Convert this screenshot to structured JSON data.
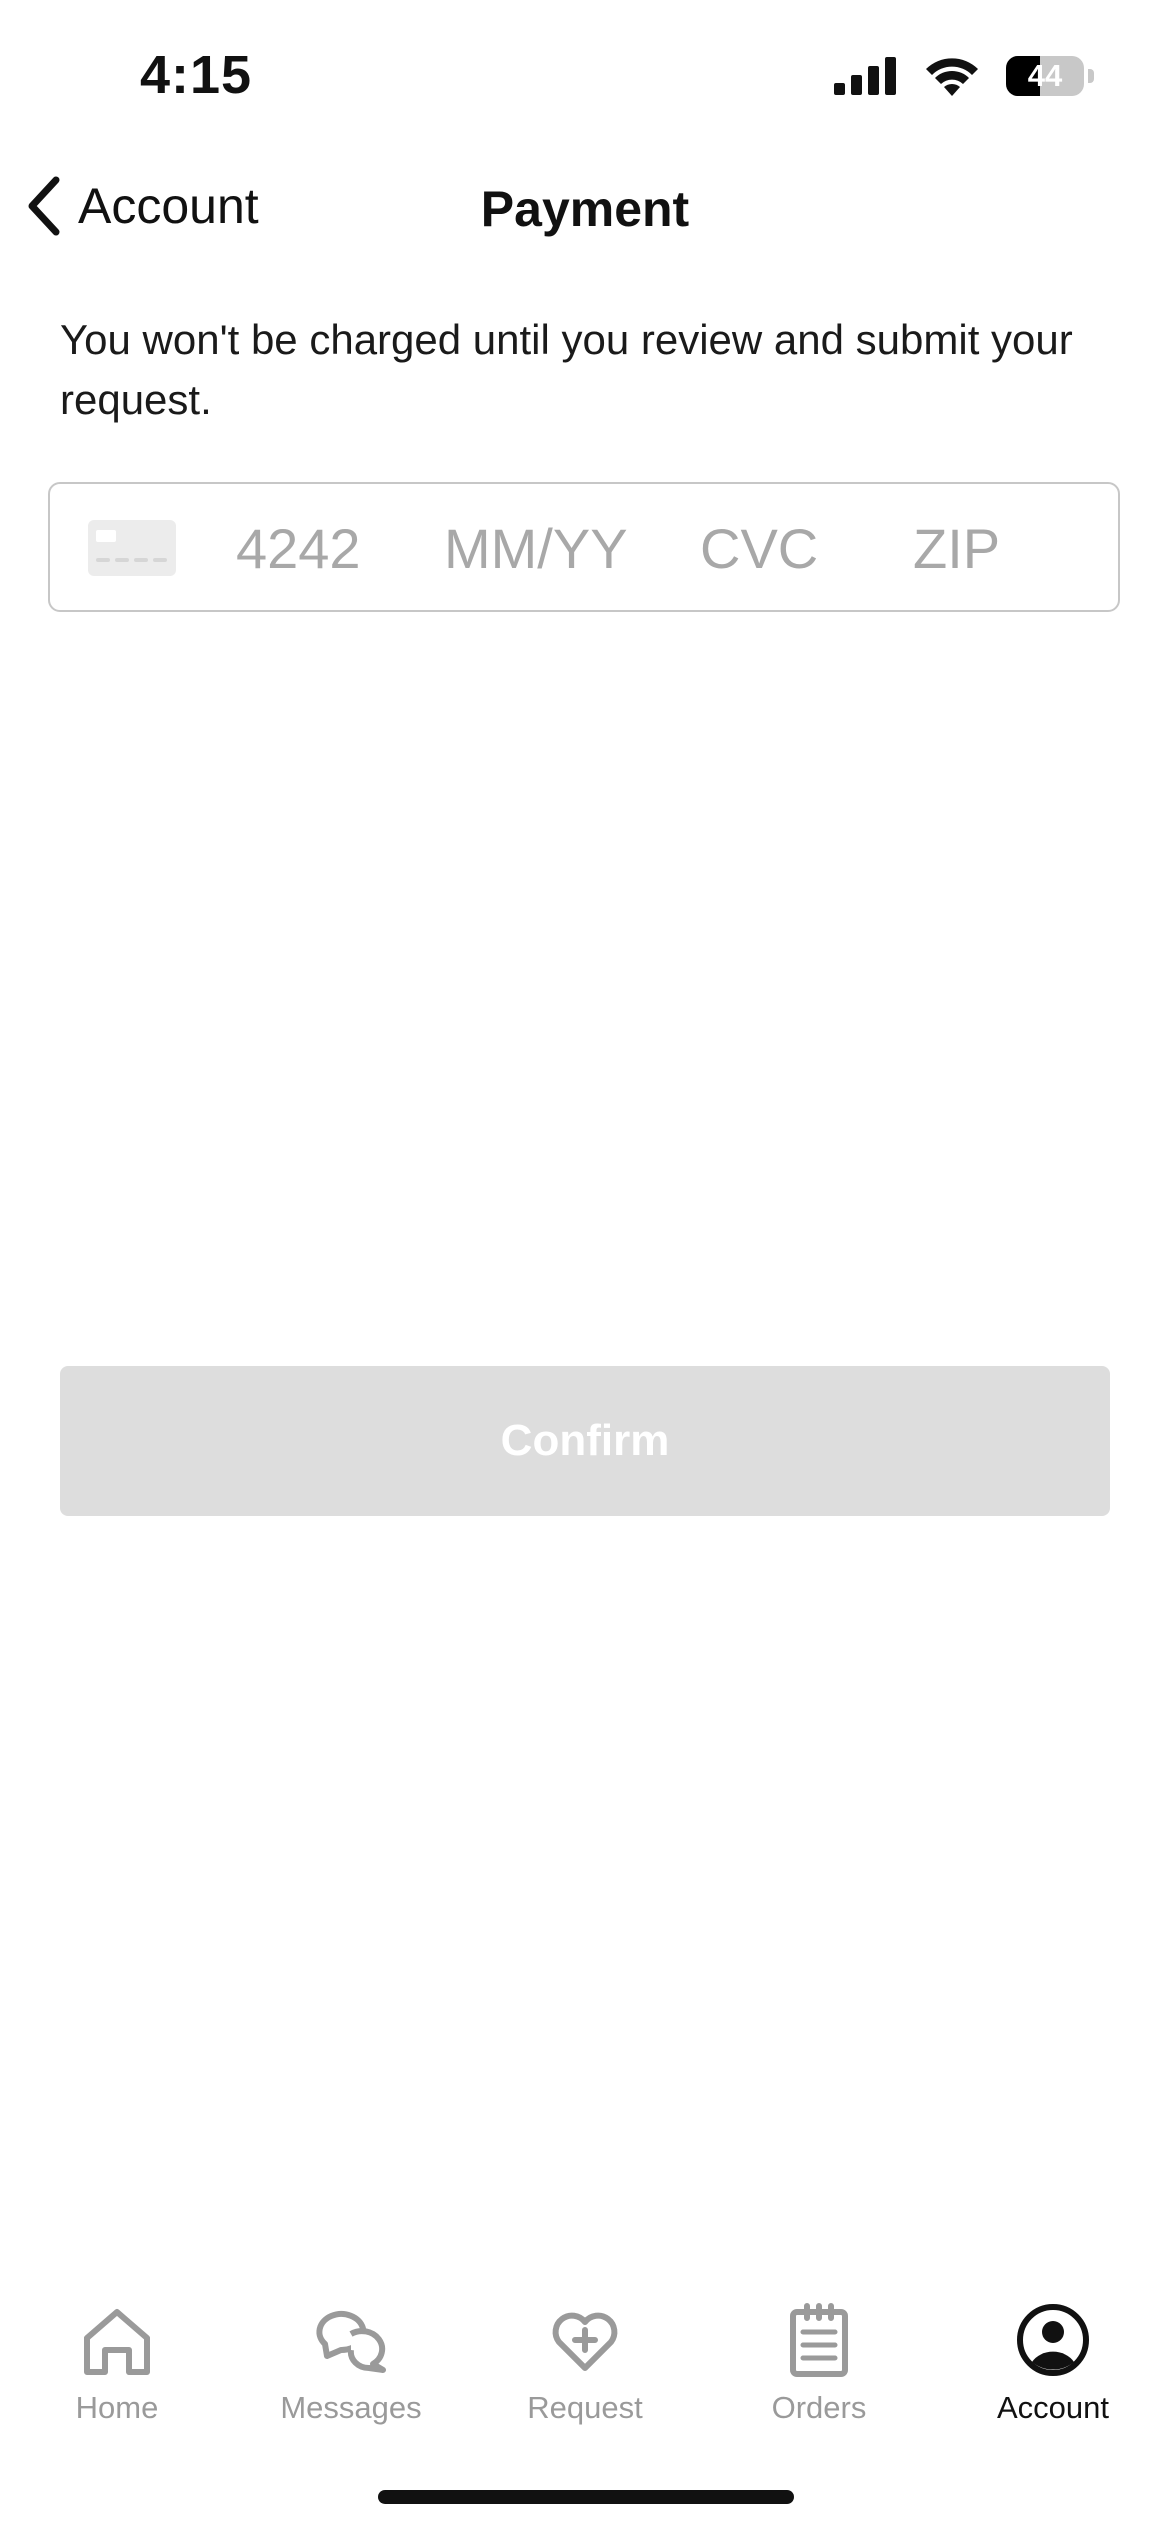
{
  "status_bar": {
    "time": "4:15",
    "battery_level": 44,
    "battery_text": "44",
    "icons": [
      "cellular-signal-icon",
      "wifi-icon",
      "battery-icon"
    ]
  },
  "nav": {
    "back_label": "Account",
    "title": "Payment"
  },
  "info_text": "You won't be charged until you review and submit your request.",
  "card_field": {
    "icon": "credit-card-icon",
    "number_placeholder": "4242",
    "expiry_placeholder": "MM/YY",
    "cvc_placeholder": "CVC",
    "zip_placeholder": "ZIP",
    "number_value": "",
    "expiry_value": "",
    "cvc_value": "",
    "zip_value": ""
  },
  "confirm_button": {
    "label": "Confirm",
    "enabled": false
  },
  "tab_bar": {
    "active": "Account",
    "tabs": [
      {
        "label": "Home",
        "icon": "home-icon"
      },
      {
        "label": "Messages",
        "icon": "messages-icon"
      },
      {
        "label": "Request",
        "icon": "heart-plus-icon"
      },
      {
        "label": "Orders",
        "icon": "clipboard-icon"
      },
      {
        "label": "Account",
        "icon": "account-icon"
      }
    ]
  },
  "colors": {
    "text": "#111111",
    "muted": "#9a9a9a",
    "placeholder": "#a8a8a8",
    "border": "#c7c7c7",
    "disabled_button": "#dddddd"
  }
}
